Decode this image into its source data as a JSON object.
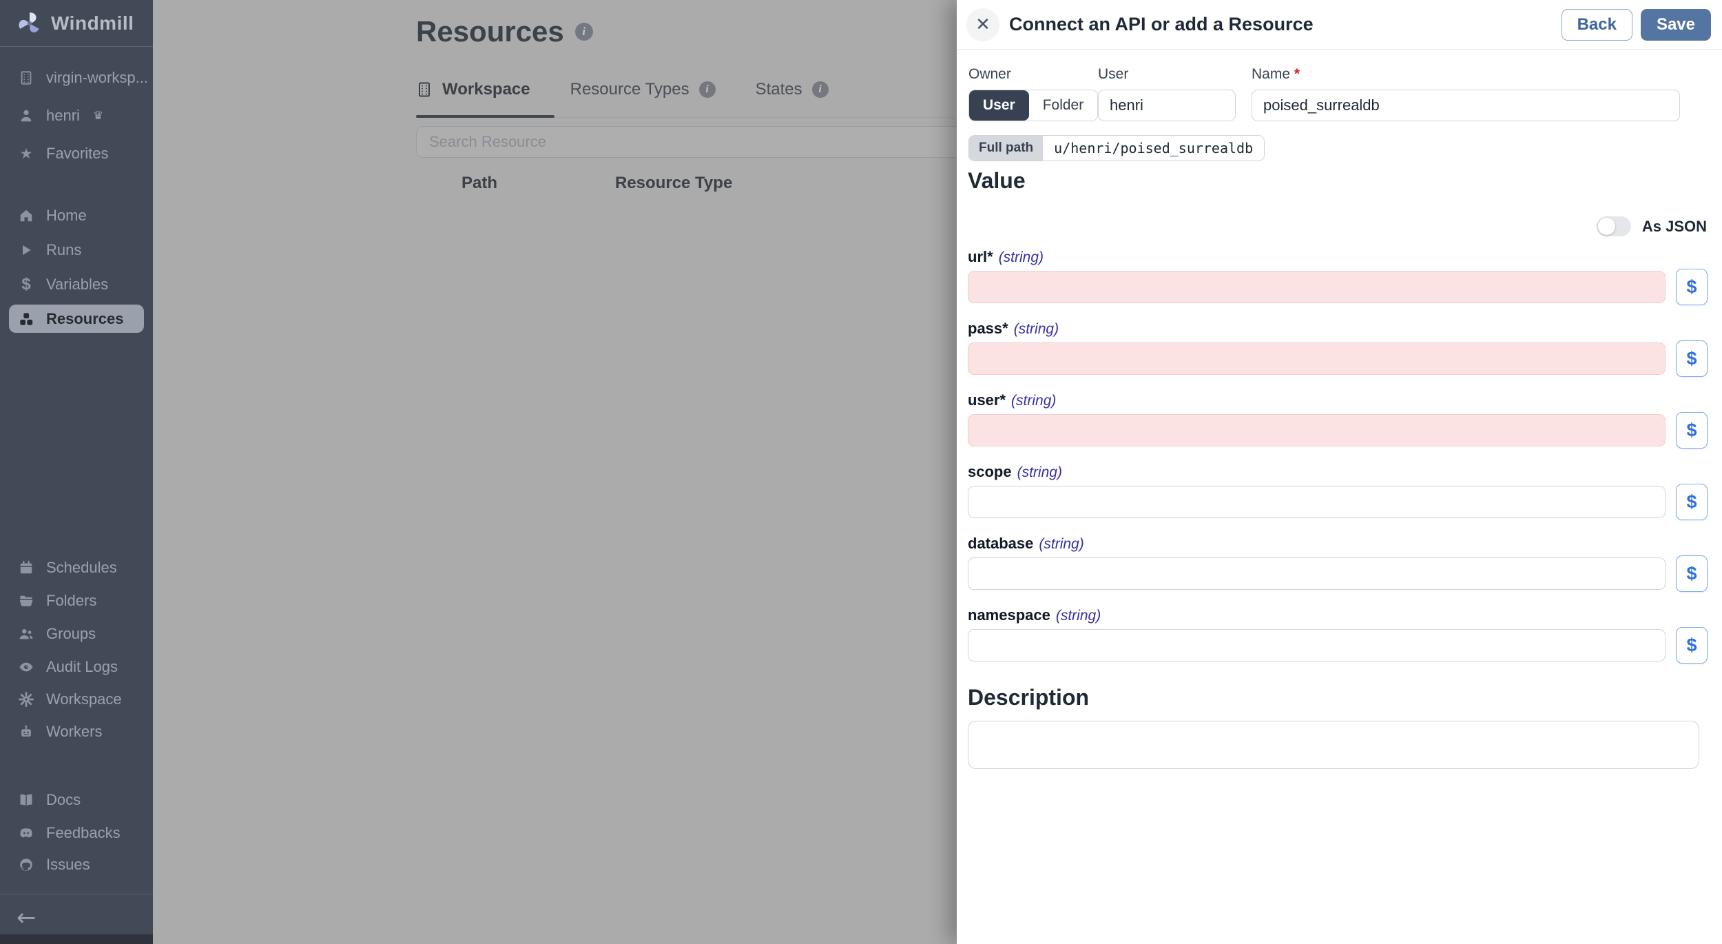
{
  "app": {
    "name": "Windmill"
  },
  "colors": {
    "sidebar_bg": "#434a57",
    "sidebar_text": "#9ba1ab",
    "active_item_bg": "#9ba1ac",
    "page_dim_bg": "#ababab",
    "drawer_bg": "#ffffff",
    "primary_button": "#5474a2",
    "link_blue": "#3f659b",
    "required_field_bg": "#fbe3e3",
    "dollar_accent": "#2f6fe0",
    "required_star": "#dc2626",
    "type_indigo": "#3730a3"
  },
  "icons": {
    "close": "✕",
    "star": "★",
    "play": "▶",
    "dollar": "$",
    "crown": "♛",
    "arrow_left": "←",
    "info": "i"
  },
  "sidebar": {
    "workspace_name": "virgin-worksp...",
    "user_name": "henri",
    "favorites_label": "Favorites",
    "nav": [
      {
        "label": "Home"
      },
      {
        "label": "Runs"
      },
      {
        "label": "Variables"
      },
      {
        "label": "Resources",
        "active": true
      }
    ],
    "admin": [
      {
        "label": "Schedules"
      },
      {
        "label": "Folders"
      },
      {
        "label": "Groups"
      },
      {
        "label": "Audit Logs"
      },
      {
        "label": "Workspace"
      },
      {
        "label": "Workers"
      }
    ],
    "links": [
      {
        "label": "Docs"
      },
      {
        "label": "Feedbacks"
      },
      {
        "label": "Issues"
      }
    ]
  },
  "main": {
    "title": "Resources",
    "tabs": [
      {
        "label": "Workspace",
        "active": true
      },
      {
        "label": "Resource Types"
      },
      {
        "label": "States"
      }
    ],
    "search_placeholder": "Search Resource",
    "table_headers": [
      "Path",
      "Resource Type"
    ]
  },
  "drawer": {
    "title": "Connect an API or add a Resource",
    "back_label": "Back",
    "save_label": "Save",
    "owner": {
      "label": "Owner",
      "options": [
        "User",
        "Folder"
      ],
      "selected": "User"
    },
    "user_field": {
      "label": "User",
      "value": "henri"
    },
    "name_field": {
      "label": "Name",
      "required_mark": "*",
      "value": "poised_surrealdb"
    },
    "full_path": {
      "label": "Full path",
      "value": "u/henri/poised_surrealdb"
    },
    "value_section": {
      "heading": "Value",
      "as_json_label": "As JSON",
      "as_json_on": false
    },
    "fields": [
      {
        "name": "url",
        "required_mark": "*",
        "type": "(string)",
        "value": ""
      },
      {
        "name": "pass",
        "required_mark": "*",
        "type": "(string)",
        "value": ""
      },
      {
        "name": "user",
        "required_mark": "*",
        "type": "(string)",
        "value": ""
      },
      {
        "name": "scope",
        "required_mark": "",
        "type": "(string)",
        "value": ""
      },
      {
        "name": "database",
        "required_mark": "",
        "type": "(string)",
        "value": ""
      },
      {
        "name": "namespace",
        "required_mark": "",
        "type": "(string)",
        "value": ""
      }
    ],
    "description": {
      "heading": "Description",
      "value": ""
    }
  }
}
